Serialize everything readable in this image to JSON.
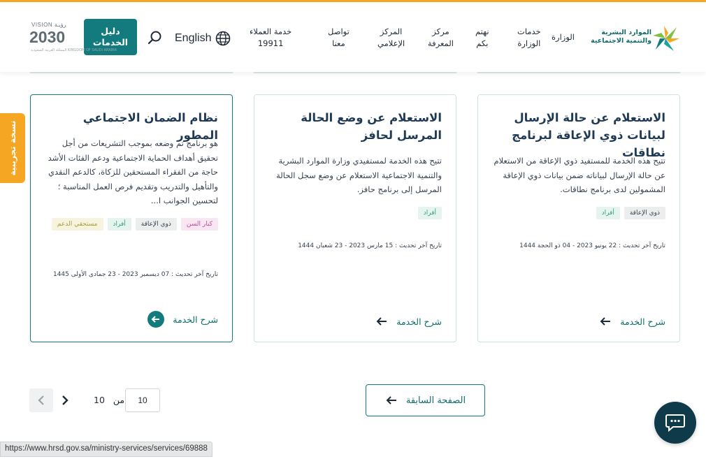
{
  "colors": {
    "accent_orange": "#f5a623",
    "primary_teal": "#137b7d",
    "title_navy": "#1f3a55",
    "chat_navy": "#0f3a4a"
  },
  "header": {
    "logo_text_line1": "الموارد البشرية",
    "logo_text_line2": "والتنمية الاجتماعية",
    "nav": [
      {
        "label": "الوزارة"
      },
      {
        "label": "خدمات\nالوزارة"
      },
      {
        "label": "نهتم\nبكم"
      },
      {
        "label": "مركز\nالمعرفة"
      },
      {
        "label": "المركز\nالإعلامي"
      },
      {
        "label": "تواصل\nمعنا"
      },
      {
        "label": "خدمة العملاء\n19911"
      }
    ],
    "language_label": "English",
    "language_icon": "globe-icon",
    "search_icon": "search-icon",
    "services_guide_label": "دليل\nالخدمات",
    "vision": {
      "top": "VISION رؤيـة",
      "number": "2030",
      "subtitle": "المملكة العربية السعودية KINGDOM OF SAUDI ARABIA"
    }
  },
  "beta_tab_label": "نسخة تجريبية",
  "cards": [
    {
      "title": "الاستعلام عن حالة الإرسال لبيانات ذوي الإعاقة لبرنامج نطاقات",
      "description": "تتيح هذه الخدمة للمستفيد ذوي الإعاقة من الاستعلام عن حالة الإرسال لبياناته ضمن بيانات ذوي الإعاقة المشمولين لدى برنامج نطاقات.",
      "tags": [
        {
          "label": "ذوي الإعاقة",
          "style": "gray"
        },
        {
          "label": "أفراد",
          "style": "green"
        }
      ],
      "updated": "تاريخ آخر تحديث : 22 يونيو 2023 - 04 ذو الحجة 1444",
      "link_label": "شرح الخدمة",
      "link_icon": "arrow-left-icon"
    },
    {
      "title": "الاستعلام عن وضع الحالة المرسل لحافز",
      "description": "تتيح هذه الخدمة لمستفيدي وزارة الموارد البشرية والتنمية الاجتماعية الاستعلام عن وضع سجل الحالة المرسل إلى برنامج حافز.",
      "tags": [
        {
          "label": "أفراد",
          "style": "green"
        }
      ],
      "updated": "تاريخ آخر تحديث : 15 مارس 2023 - 23 شعبان 1444",
      "link_label": "شرح الخدمة",
      "link_icon": "arrow-left-icon"
    },
    {
      "title": "نظام الضمان الاجتماعي المطور",
      "description": "هو برنامج تم وضعه بموجب التشريعات من أجل تحقيق أهداف الحماية الاجتماعية ودعم الفئات الأشد حاجة من الفقراء المستحقين للزكاة، كالدعم النقدي والتأهيل والتدريب وتقديم فرص العمل المناسبة ؛ لتحسين الجوانب ا...",
      "tags": [
        {
          "label": "كبار السن",
          "style": "pink"
        },
        {
          "label": "ذوي الإعاقة",
          "style": "gray"
        },
        {
          "label": "أفراد",
          "style": "green"
        },
        {
          "label": "مستحقي الدعم",
          "style": "yellow"
        }
      ],
      "updated": "تاريخ آخر تحديث : 07 ديسمبر 2023 - 23 جمادى الأولى 1445",
      "link_label": "شرح الخدمة",
      "link_icon": "arrow-left-circle-icon"
    }
  ],
  "pagination": {
    "prev_page_label": "الصفحة السابقة",
    "prev_page_icon": "arrow-left-icon",
    "current_page": "10",
    "of_label": "من",
    "total_pages": "10",
    "next_icon": "chevron-right-icon",
    "prev_icon": "chevron-left-icon"
  },
  "chat_icon": "chat-bubble-icon",
  "status_bar_url": "https://www.hrsd.gov.sa/ministry-services/services/69888"
}
